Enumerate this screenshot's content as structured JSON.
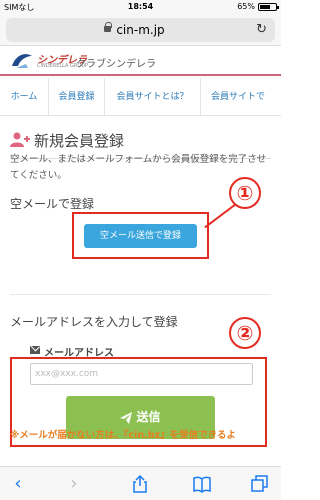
{
  "status_bar": {
    "carrier": "SIMなし",
    "time": "18:54",
    "battery": "65%"
  },
  "browser": {
    "url": "cin-m.jp",
    "reload_icon": "reload-icon",
    "toolbar_icons": [
      "back-icon",
      "forward-icon",
      "share-icon",
      "bookmarks-icon",
      "tabs-icon"
    ]
  },
  "site": {
    "logo_text": "シンデレラ",
    "logo_sub": "CINDERELLA GROUP",
    "brand_name": "クラブシンデレラ",
    "accent_color": "#c9657a"
  },
  "nav": {
    "items": [
      "ホーム",
      "会員登録",
      "会員サイトとは？",
      "会員サイトで"
    ]
  },
  "main": {
    "title": "新規会員登録",
    "intro": "空メール、またはメールフォームから会員仮登録を完了させてください。",
    "section1_heading": "空メールで登録",
    "empty_mail_button": "空メール送信で登録",
    "section2_heading": "メールアドレスを入力して登録",
    "mail_label": "メールアドレス",
    "email_placeholder": "xxx@xxx.com",
    "send_button": "送信",
    "notice": "※メールが届かない方は、『cin.bz』を受信できるよ"
  },
  "annotations": {
    "badge1": "①",
    "badge2": "②",
    "callout_color": "#e32b22"
  }
}
